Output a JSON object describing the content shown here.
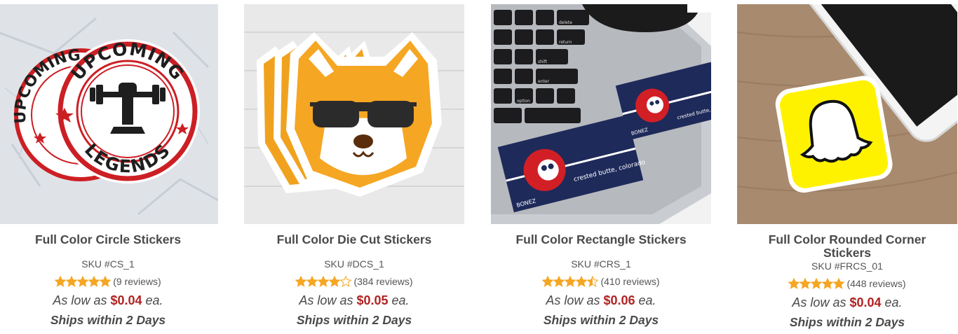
{
  "products": [
    {
      "title": "Full Color Circle Stickers",
      "sku": "SKU #CS_1",
      "rating": 5,
      "reviews": "(9 reviews)",
      "price_prefix": "As low as",
      "price": "$0.04",
      "price_suffix": "ea.",
      "ships": "Ships within 2 Days",
      "image_text": [
        "UPCOMING",
        "LEGENDS"
      ]
    },
    {
      "title": "Full Color Die Cut Stickers",
      "sku": "SKU #DCS_1",
      "rating": 4,
      "reviews": "(384 reviews)",
      "price_prefix": "As low as",
      "price": "$0.05",
      "price_suffix": "ea.",
      "ships": "Ships within 2 Days"
    },
    {
      "title": "Full Color Rectangle Stickers",
      "sku": "SKU #CRS_1",
      "rating": 4.5,
      "reviews": "(410 reviews)",
      "price_prefix": "As low as",
      "price": "$0.06",
      "price_suffix": "ea.",
      "ships": "Ships within 2 Days",
      "image_text": [
        "BONEZ",
        "crested butte, colorado",
        "delete",
        "return",
        "shift",
        "option",
        "enter"
      ]
    },
    {
      "title": "Full Color Rounded Corner Stickers",
      "sku": "SKU #FRCS_01",
      "rating": 5,
      "reviews": "(448 reviews)",
      "price_prefix": "As low as",
      "price": "$0.04",
      "price_suffix": "ea.",
      "ships": "Ships within 2 Days"
    }
  ],
  "colors": {
    "star": "#f5a623",
    "price": "#b22222",
    "text": "#4a4a4a"
  }
}
